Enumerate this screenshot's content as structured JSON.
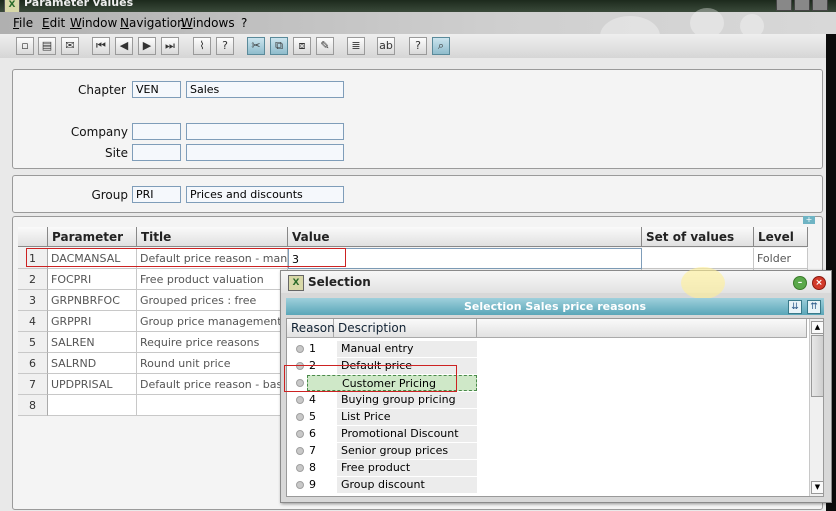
{
  "window": {
    "title": "Parameter values"
  },
  "menu": [
    "File",
    "Edit",
    "Window",
    "Navigation",
    "Windows",
    "?"
  ],
  "header": {
    "chapter_label": "Chapter",
    "chapter_code": "VEN",
    "chapter_name": "Sales",
    "company_label": "Company",
    "company_code": "",
    "company_name": "",
    "site_label": "Site",
    "site_code": "",
    "site_name": "",
    "group_label": "Group",
    "group_code": "PRI",
    "group_name": "Prices and discounts"
  },
  "table": {
    "columns": [
      "Parameter",
      "Title",
      "Value",
      "Set of values",
      "Level"
    ],
    "rows": [
      {
        "num": "1",
        "parameter": "DACMANSAL",
        "title": "Default price reason - manual",
        "value": "3",
        "set": "",
        "level": "Folder"
      },
      {
        "num": "2",
        "parameter": "FOCPRI",
        "title": "Free product valuation",
        "value": "",
        "set": "",
        "level": ""
      },
      {
        "num": "3",
        "parameter": "GRPNBRFOC",
        "title": "Grouped prices : free",
        "value": "",
        "set": "",
        "level": ""
      },
      {
        "num": "4",
        "parameter": "GRPPRI",
        "title": "Group price management",
        "value": "",
        "set": "",
        "level": ""
      },
      {
        "num": "5",
        "parameter": "SALREN",
        "title": "Require price reasons",
        "value": "",
        "set": "",
        "level": ""
      },
      {
        "num": "6",
        "parameter": "SALRND",
        "title": "Round unit price",
        "value": "",
        "set": "",
        "level": ""
      },
      {
        "num": "7",
        "parameter": "UPDPRISAL",
        "title": "Default price reason - base",
        "value": "",
        "set": "",
        "level": ""
      },
      {
        "num": "8",
        "parameter": "",
        "title": "",
        "value": "",
        "set": "",
        "level": ""
      }
    ]
  },
  "selection": {
    "title": "Selection",
    "band": "Selection Sales price reasons",
    "columns": [
      "Reason",
      "Description"
    ],
    "items": [
      {
        "code": "1",
        "desc": "Manual entry"
      },
      {
        "code": "2",
        "desc": "Default price"
      },
      {
        "code": "3",
        "desc": "Customer Pricing"
      },
      {
        "code": "4",
        "desc": "Buying group pricing"
      },
      {
        "code": "5",
        "desc": "List Price"
      },
      {
        "code": "6",
        "desc": "Promotional Discount"
      },
      {
        "code": "7",
        "desc": "Senior group prices"
      },
      {
        "code": "8",
        "desc": "Free product"
      },
      {
        "code": "9",
        "desc": "Group discount"
      }
    ],
    "selected_index": 2
  },
  "colors": {
    "highlight_red": "#cc2222",
    "selection_green": "#cfe8c8",
    "band": "#6fb4c4"
  }
}
